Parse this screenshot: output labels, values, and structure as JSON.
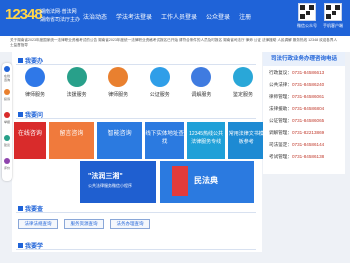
{
  "header": {
    "logo_mark": "12348",
    "logo_line1": "湖南法网·普法网",
    "logo_line2": "湖南省司法厅主办",
    "nav": [
      "法治动态",
      "学法考法登录",
      "工作人员登录",
      "公众登录",
      "注册"
    ],
    "qr_labels": [
      "微信公众号",
      "手机客户端"
    ]
  },
  "notice": {
    "text": "关于湖南省2023年度国家统一法律职业资格考试的公告 湖南省2023年度统一法律职业资格考试报名已开始 请符合条件的人员及时报名 湖南省司法厅 律师 公证 法律援助 人民调解 服务热线 12348 欢迎各界人士监督指导"
  },
  "float_items": [
    "在线咨询",
    "投诉",
    "举报",
    "建议",
    "评价"
  ],
  "section_services": {
    "title": "我要办"
  },
  "services": [
    {
      "label": "律师服务",
      "color": "#2f78e8"
    },
    {
      "label": "法援服务",
      "color": "#28a08a"
    },
    {
      "label": "律师服务",
      "color": "#e9802f"
    },
    {
      "label": "公证服务",
      "color": "#2f9ee8"
    },
    {
      "label": "调解服务",
      "color": "#3f7be0"
    },
    {
      "label": "鉴定服务",
      "color": "#29a7d8"
    }
  ],
  "section_ask": {
    "title": "我要问"
  },
  "tiles": [
    {
      "label": "在线咨询",
      "color": "#d92b2b"
    },
    {
      "label": "留言咨询",
      "color": "#f07a3c"
    },
    {
      "label": "智能咨询",
      "color": "#2b7ae0"
    },
    {
      "label": "线下实体地址查找",
      "color": "#2b7ae0"
    },
    {
      "label": "12345热线公共法律服务专线",
      "color": "#1fa0d8"
    },
    {
      "label": "常用法律文书模板参考",
      "color": "#1d8ad3"
    }
  ],
  "banners": {
    "left_title": "\"法润三湘\"",
    "left_sub": "公共法律服务微信小程序",
    "right_title": "民法典"
  },
  "section_check": {
    "title": "我要查"
  },
  "pills": [
    "法律法规查询",
    "服务资源查询",
    "法务办理查询"
  ],
  "section_learn": {
    "title": "我要学"
  },
  "hotline": {
    "title": "司法行政业务办理咨询电话",
    "rows": [
      {
        "name": "行政复议",
        "phone": "0731-84586613"
      },
      {
        "name": "公共法律",
        "phone": "0731-84586240"
      },
      {
        "name": "律师管理",
        "phone": "0731-84586061"
      },
      {
        "name": "法律援助",
        "phone": "0731-84586804"
      },
      {
        "name": "公证管理",
        "phone": "0731-84586065"
      },
      {
        "name": "调解管理",
        "phone": "0731-82213869"
      },
      {
        "name": "司法鉴定",
        "phone": "0731-84586144"
      },
      {
        "name": "考试管理",
        "phone": "0731-84586138"
      }
    ]
  },
  "colors": {
    "brand": "#1f63d8",
    "background": "#eef1f6"
  }
}
